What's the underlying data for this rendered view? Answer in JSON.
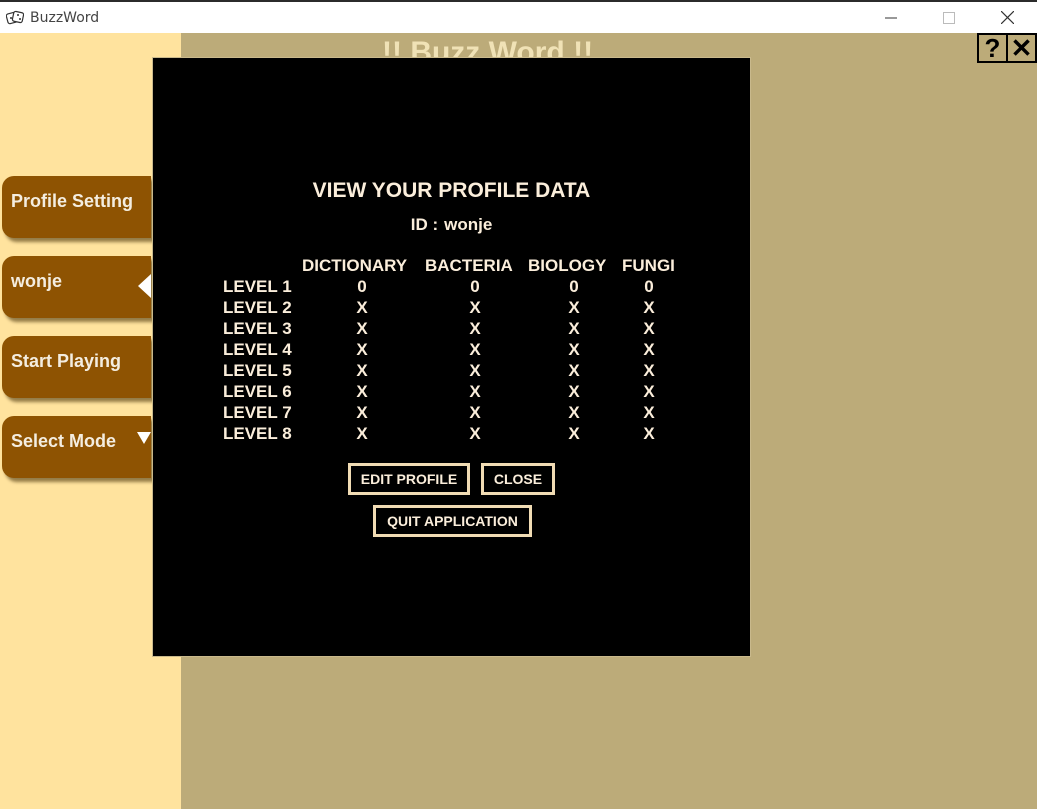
{
  "window": {
    "title": "BuzzWord",
    "minimize_symbol": "—",
    "maximize_symbol": "☐",
    "close_symbol": "✕"
  },
  "sidebar": {
    "items": [
      {
        "label": "Profile Setting"
      },
      {
        "label": "wonje"
      },
      {
        "label": "Start Playing"
      },
      {
        "label": "Select Mode"
      }
    ]
  },
  "header": {
    "title": "!! Buzz Word !!",
    "help_label": "?",
    "exit_label": "✕"
  },
  "modal": {
    "title": "VIEW YOUR PROFILE DATA",
    "id_label": "ID :",
    "id_value": "wonje",
    "columns": [
      "DICTIONARY",
      "BACTERIA",
      "BIOLOGY",
      "FUNGI"
    ],
    "rows": [
      {
        "label": "LEVEL 1",
        "values": [
          "0",
          "0",
          "0",
          "0"
        ]
      },
      {
        "label": "LEVEL 2",
        "values": [
          "X",
          "X",
          "X",
          "X"
        ]
      },
      {
        "label": "LEVEL 3",
        "values": [
          "X",
          "X",
          "X",
          "X"
        ]
      },
      {
        "label": "LEVEL 4",
        "values": [
          "X",
          "X",
          "X",
          "X"
        ]
      },
      {
        "label": "LEVEL 5",
        "values": [
          "X",
          "X",
          "X",
          "X"
        ]
      },
      {
        "label": "LEVEL 6",
        "values": [
          "X",
          "X",
          "X",
          "X"
        ]
      },
      {
        "label": "LEVEL 7",
        "values": [
          "X",
          "X",
          "X",
          "X"
        ]
      },
      {
        "label": "LEVEL 8",
        "values": [
          "X",
          "X",
          "X",
          "X"
        ]
      }
    ],
    "buttons": {
      "edit_profile": "EDIT PROFILE",
      "close": "CLOSE",
      "quit": "QUIT APPLICATION"
    }
  },
  "colors": {
    "background": "#bcab79",
    "sidebar": "#ffe39e",
    "sidebar_button": "#8e5302",
    "modal": "#000000",
    "modal_text": "#fbeedb"
  }
}
